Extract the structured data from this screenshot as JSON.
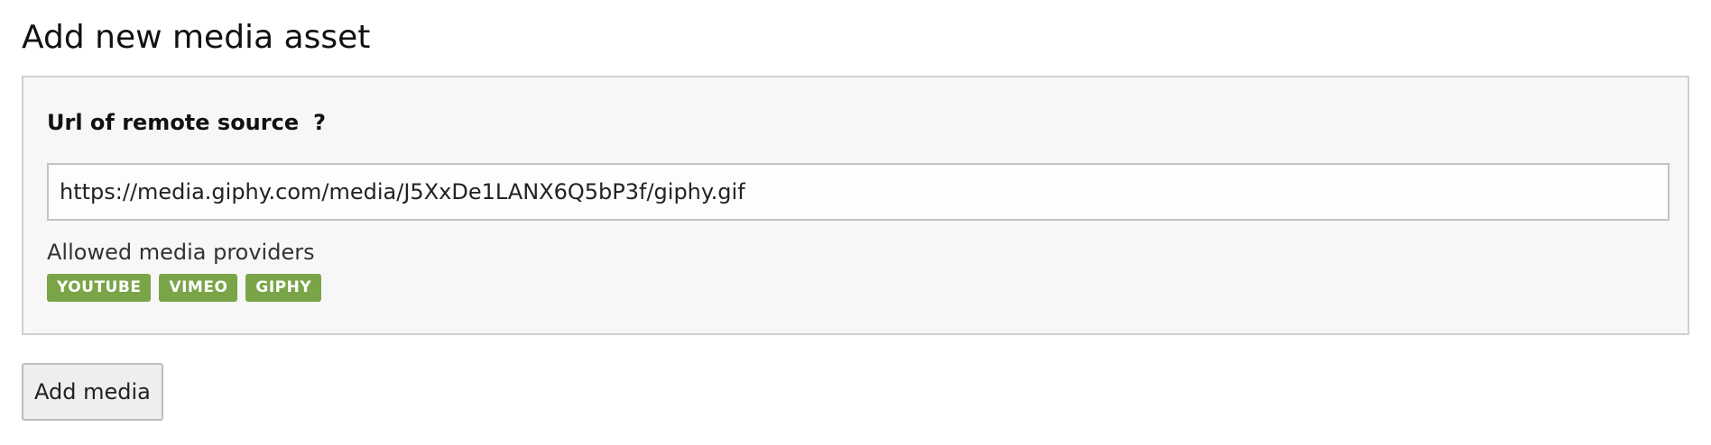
{
  "page": {
    "title": "Add new media asset"
  },
  "form": {
    "url_label": "Url of remote source",
    "help_icon": "?",
    "url_value": "https://media.giphy.com/media/J5XxDe1LANX6Q5bP3f/giphy.gif",
    "providers_label": "Allowed media providers",
    "providers": [
      {
        "name": "YOUTUBE"
      },
      {
        "name": "VIMEO"
      },
      {
        "name": "GIPHY"
      }
    ],
    "submit_label": "Add media"
  },
  "colors": {
    "badge_bg": "#79a548",
    "panel_bg": "#f7f7f7",
    "panel_border": "#cfcfcf"
  }
}
